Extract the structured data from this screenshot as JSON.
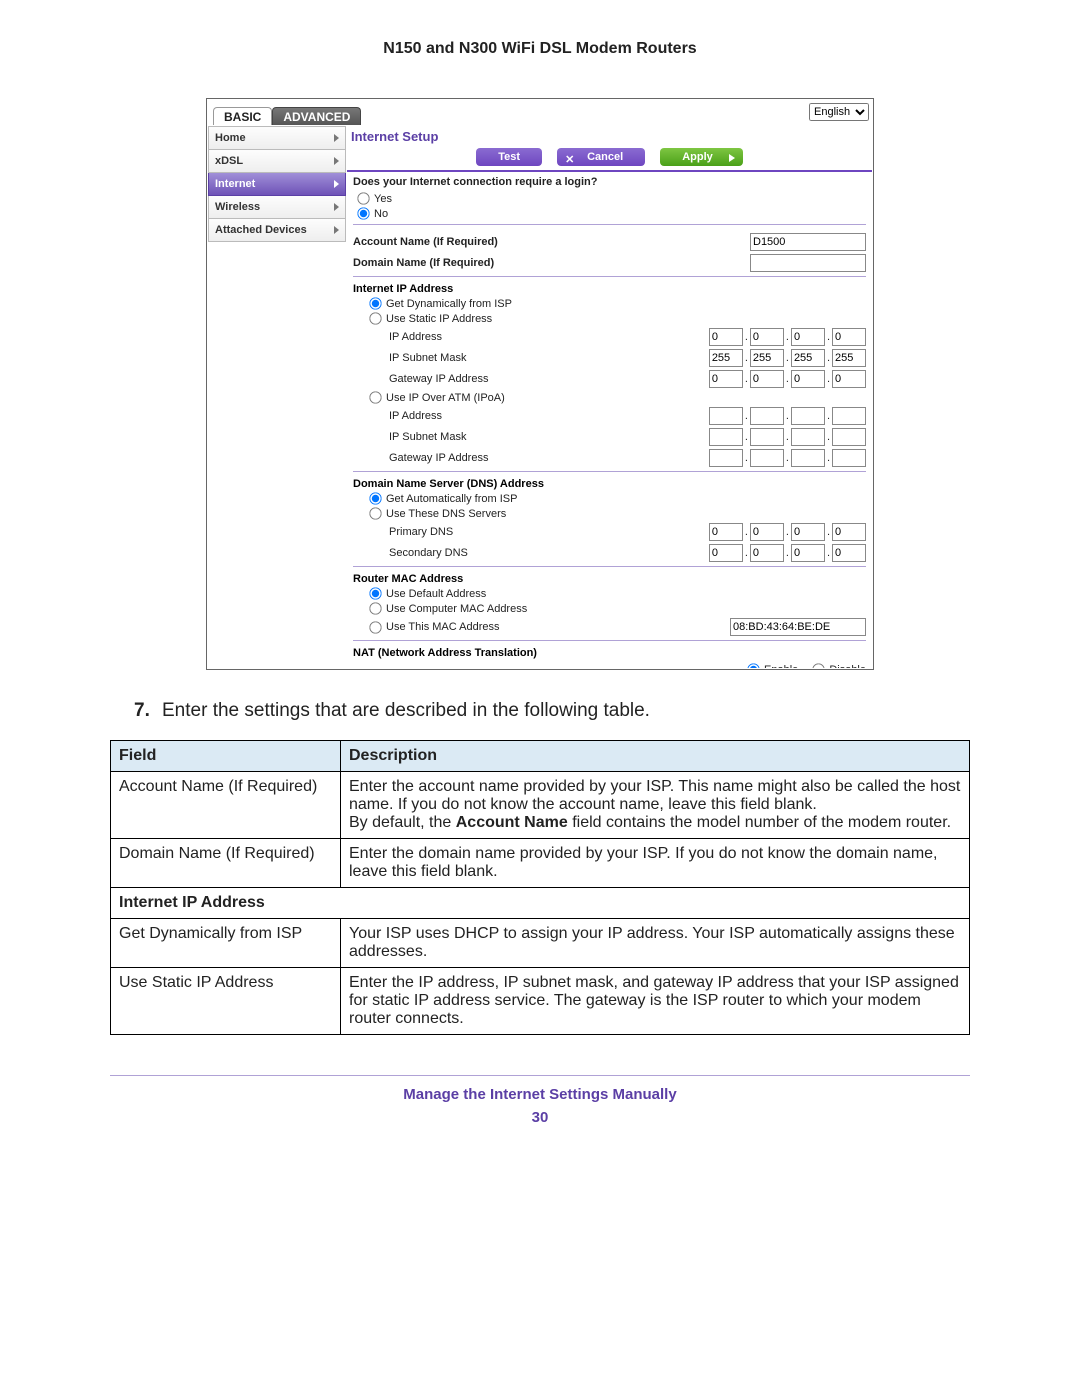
{
  "doc": {
    "title": "N150 and N300 WiFi DSL Modem Routers",
    "step_num": "7.",
    "step_text": "Enter the settings that are described in the following table.",
    "footer_title": "Manage the Internet Settings Manually",
    "page_number": "30"
  },
  "lang": {
    "value": "English"
  },
  "tabs": {
    "basic": "BASIC",
    "advanced": "ADVANCED"
  },
  "nav": {
    "items": [
      {
        "label": "Home"
      },
      {
        "label": "xDSL"
      },
      {
        "label": "Internet"
      },
      {
        "label": "Wireless"
      },
      {
        "label": "Attached Devices"
      }
    ]
  },
  "panel": {
    "title": "Internet Setup",
    "buttons": {
      "test": "Test",
      "cancel": "Cancel",
      "apply": "Apply"
    },
    "question": "Does your Internet connection require a login?",
    "yes": "Yes",
    "no": "No",
    "account_name_label": "Account Name  (If Required)",
    "account_name_value": "D1500",
    "domain_name_label": "Domain Name  (If Required)",
    "ip_section": "Internet IP Address",
    "ip_dyn": "Get Dynamically from ISP",
    "ip_static": "Use Static IP Address",
    "ip_addr": "IP Address",
    "ip_mask": "IP Subnet Mask",
    "ip_gw": "Gateway IP Address",
    "ip_ipoa": "Use IP Over ATM (IPoA)",
    "static_ip": {
      "a": "0",
      "b": "0",
      "c": "0",
      "d": "0"
    },
    "static_mask": {
      "a": "255",
      "b": "255",
      "c": "255",
      "d": "255"
    },
    "static_gw": {
      "a": "0",
      "b": "0",
      "c": "0",
      "d": "0"
    },
    "dns_section": "Domain Name Server (DNS) Address",
    "dns_auto": "Get Automatically from ISP",
    "dns_use": "Use These DNS Servers",
    "dns_primary": "Primary DNS",
    "dns_secondary": "Secondary DNS",
    "dns_p": {
      "a": "0",
      "b": "0",
      "c": "0",
      "d": "0"
    },
    "dns_s": {
      "a": "0",
      "b": "0",
      "c": "0",
      "d": "0"
    },
    "mac_section": "Router MAC Address",
    "mac_default": "Use Default Address",
    "mac_computer": "Use Computer MAC Address",
    "mac_this": "Use This MAC Address",
    "mac_value": "08:BD:43:64:BE:DE",
    "nat_section": "NAT (Network Address Translation)",
    "nat_enable": "Enable",
    "nat_disable": "Disable"
  },
  "table": {
    "h_field": "Field",
    "h_desc": "Description",
    "rows": [
      {
        "field": "Account Name (If Required)",
        "desc_html": "Enter the account name provided by your ISP. This name might also be called the host name. If you do not know the account name, leave this field blank.<br>By default, the <b>Account Name</b> field contains the model number of the modem router."
      },
      {
        "field": "Domain Name (If Required)",
        "desc_html": "Enter the domain name provided by your ISP. If you do not know the domain name, leave this field blank."
      }
    ],
    "section2": "Internet IP Address",
    "rows2": [
      {
        "field": "Get Dynamically from ISP",
        "desc_html": "Your ISP uses DHCP to assign your IP address. Your ISP automatically assigns these addresses."
      },
      {
        "field": "Use Static IP Address",
        "desc_html": "Enter the IP address, IP subnet mask, and gateway IP address that your ISP assigned for static IP address service. The gateway is the ISP router to which your modem router connects."
      }
    ]
  }
}
